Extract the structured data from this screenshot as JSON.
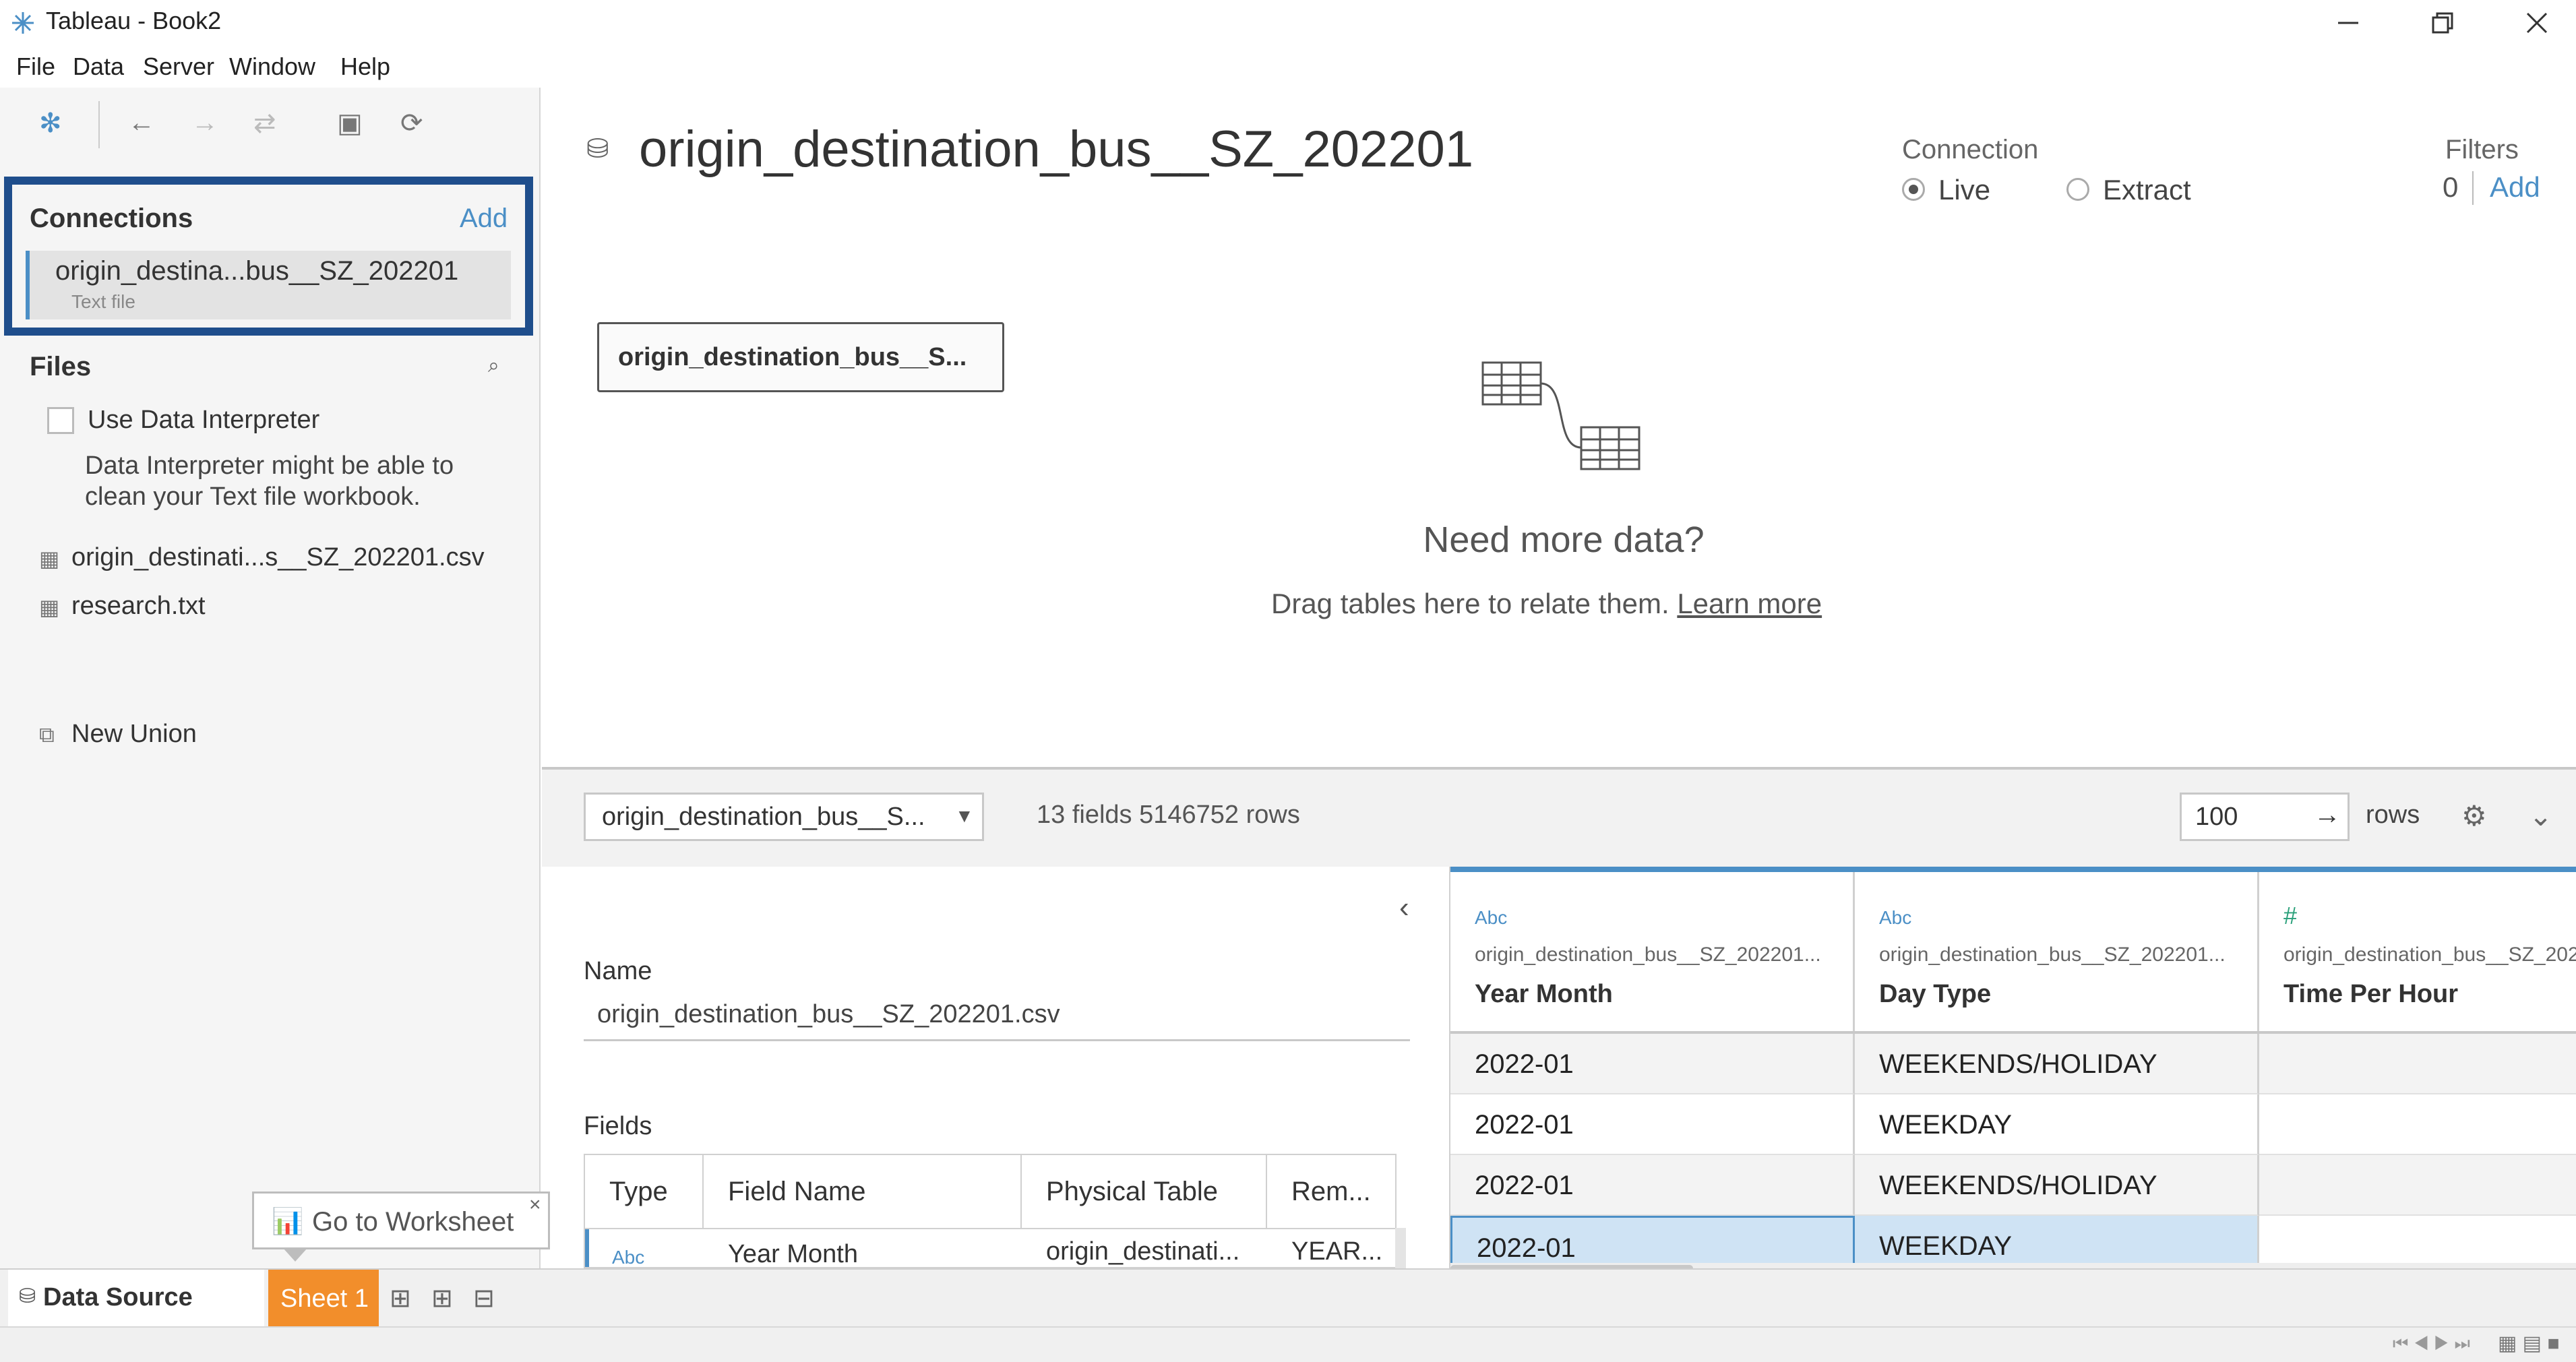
{
  "window": {
    "title": "Tableau - Book2"
  },
  "menu": [
    "File",
    "Data",
    "Server",
    "Window",
    "Help"
  ],
  "connections": {
    "heading": "Connections",
    "add_label": "Add",
    "item_name": "origin_destina...bus__SZ_202201",
    "item_type": "Text file"
  },
  "files": {
    "heading": "Files",
    "interpreter_label": "Use Data Interpreter",
    "interpreter_desc_1": "Data Interpreter might be able to",
    "interpreter_desc_2": "clean your Text file workbook.",
    "items": [
      "origin_destinati...s__SZ_202201.csv",
      "research.txt"
    ],
    "new_union": "New Union"
  },
  "canvas": {
    "title": "origin_destination_bus__SZ_202201",
    "connection_label": "Connection",
    "live_label": "Live",
    "extract_label": "Extract",
    "connection_mode": "Live",
    "filters_label": "Filters",
    "filters_count": "0",
    "filters_add": "Add",
    "table_chip": "origin_destination_bus__S...",
    "need_more": "Need more data?",
    "drag_text": "Drag tables here to relate them.",
    "learn_more": "Learn more"
  },
  "metabar": {
    "table_select": "origin_destination_bus__S...",
    "summary": "13 fields 5146752 rows",
    "rows_value": "100",
    "rows_label": "rows"
  },
  "details": {
    "name_label": "Name",
    "name_value": "origin_destination_bus__SZ_202201.csv",
    "fields_label": "Fields",
    "columns": [
      "Type",
      "Field Name",
      "Physical Table",
      "Rem..."
    ],
    "row": {
      "type": "Abc",
      "field": "Year Month",
      "table": "origin_destinati...",
      "remote": "YEAR..."
    }
  },
  "grid": {
    "columns": [
      {
        "type": "Abc",
        "source": "origin_destination_bus__SZ_202201...",
        "name": "Year Month"
      },
      {
        "type": "Abc",
        "source": "origin_destination_bus__SZ_202201...",
        "name": "Day Type"
      },
      {
        "type": "#",
        "source": "origin_destination_bus__SZ_202",
        "name": "Time Per Hour"
      }
    ],
    "rows": [
      [
        "2022-01",
        "WEEKENDS/HOLIDAY",
        ""
      ],
      [
        "2022-01",
        "WEEKDAY",
        ""
      ],
      [
        "2022-01",
        "WEEKENDS/HOLIDAY",
        ""
      ],
      [
        "2022-01",
        "WEEKDAY",
        ""
      ]
    ]
  },
  "tabs": {
    "data_source": "Data Source",
    "sheet1": "Sheet 1",
    "tooltip": "Go to Worksheet"
  },
  "colors": {
    "accent": "#4b8fc6",
    "highlight_box": "#1f4e8c",
    "sheet_tab": "#f28e2b"
  }
}
